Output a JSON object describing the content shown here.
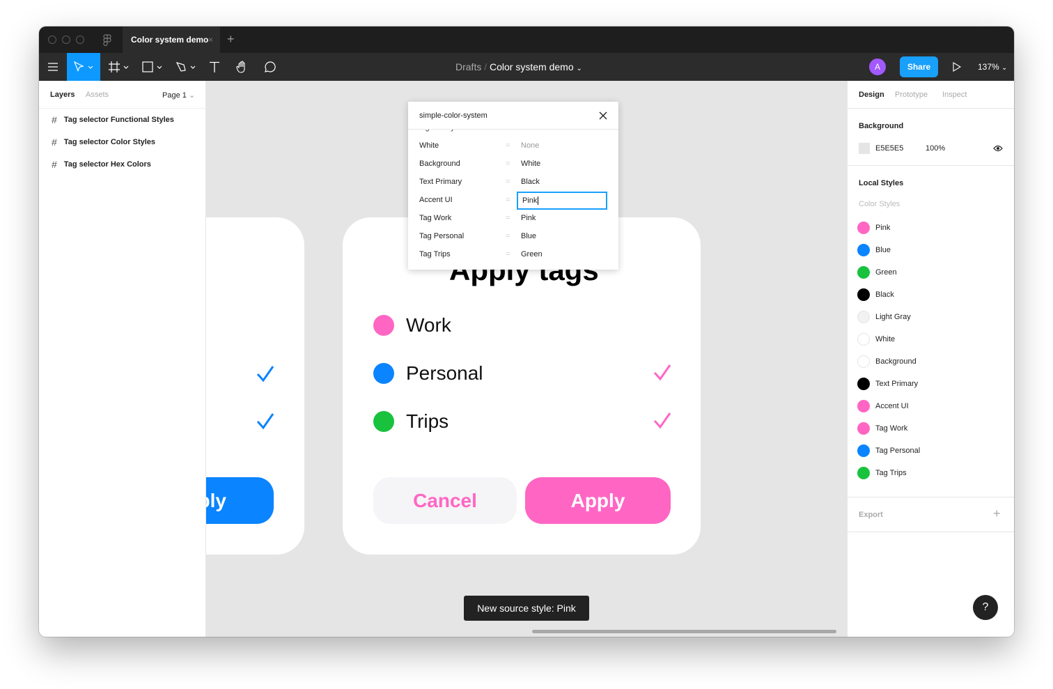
{
  "titlebar": {
    "tab": "Color system demo",
    "close": "×",
    "new_tab": "+"
  },
  "toolbar": {
    "crumb_parent": "Drafts",
    "crumb_sep": "/",
    "crumb_file": "Color system demo",
    "avatar": "A",
    "share": "Share",
    "zoom": "137%"
  },
  "left": {
    "tabs": [
      "Layers",
      "Assets"
    ],
    "page": "Page 1",
    "layers": [
      "Tag selector Functional Styles",
      "Tag selector Color Styles",
      "Tag selector Hex Colors"
    ]
  },
  "right": {
    "tabs": [
      "Design",
      "Prototype",
      "Inspect"
    ],
    "background_title": "Background",
    "bg_hex": "E5E5E5",
    "bg_opacity": "100%",
    "local_styles": "Local Styles",
    "color_styles": "Color Styles",
    "export": "Export",
    "styles": [
      {
        "name": "Pink",
        "color": "#ff66c4"
      },
      {
        "name": "Blue",
        "color": "#0a84ff"
      },
      {
        "name": "Green",
        "color": "#18c23d"
      },
      {
        "name": "Black",
        "color": "#000000"
      },
      {
        "name": "Light Gray",
        "color": "#f2f2f2"
      },
      {
        "name": "White",
        "color": "#ffffff"
      },
      {
        "name": "Background",
        "color": "#ffffff"
      },
      {
        "name": "Text Primary",
        "color": "#000000"
      },
      {
        "name": "Accent UI",
        "color": "#ff66c4"
      },
      {
        "name": "Tag Work",
        "color": "#ff66c4"
      },
      {
        "name": "Tag Personal",
        "color": "#0a84ff"
      },
      {
        "name": "Tag Trips",
        "color": "#18c23d"
      }
    ]
  },
  "popup": {
    "title": "simple-color-system",
    "rows": [
      {
        "k": "Light Gray",
        "v": "None"
      },
      {
        "k": "White",
        "v": "None"
      },
      {
        "k": "Background",
        "v": "White"
      },
      {
        "k": "Text Primary",
        "v": "Black"
      },
      {
        "k": "Accent UI",
        "v": "Pink"
      },
      {
        "k": "Tag Work",
        "v": "Pink"
      },
      {
        "k": "Tag Personal",
        "v": "Blue"
      },
      {
        "k": "Tag Trips",
        "v": "Green"
      }
    ],
    "eq": "="
  },
  "card": {
    "title": "Apply tags",
    "tags": [
      {
        "name": "Work",
        "color": "#ff66c4",
        "checked": false
      },
      {
        "name": "Personal",
        "color": "#0a84ff",
        "checked": true
      },
      {
        "name": "Trips",
        "color": "#18c23d",
        "checked": true
      }
    ],
    "cancel": "Cancel",
    "apply": "Apply",
    "left_apply": "ply"
  },
  "toast": "New source style: Pink",
  "help": "?",
  "colors": {
    "accent": "#ff66c4",
    "blue": "#0a84ff",
    "figma_blue": "#18a0fb"
  }
}
